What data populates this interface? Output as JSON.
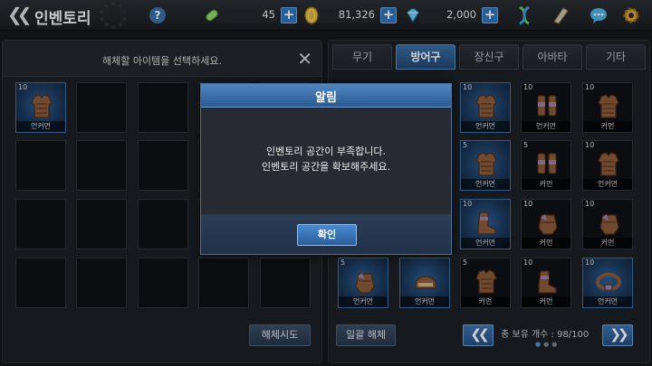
{
  "header": {
    "title": "인벤토리",
    "energy": "45",
    "gold": "81,326",
    "gems": "2,000",
    "plus_label": "+",
    "help_label": "?"
  },
  "left_panel": {
    "prompt": "해체할 아이템을 선택하세요.",
    "close_label": "✕",
    "dismantle_label": "해체시도",
    "slots": [
      {
        "count": "10",
        "name": "언커먼",
        "filled": true
      },
      {
        "filled": false
      },
      {
        "filled": false
      },
      {
        "filled": false
      },
      {
        "filled": false
      },
      {
        "filled": false
      },
      {
        "filled": false
      },
      {
        "filled": false
      },
      {
        "filled": false
      },
      {
        "filled": false
      },
      {
        "filled": false
      },
      {
        "filled": false
      },
      {
        "filled": false
      },
      {
        "filled": false
      },
      {
        "filled": false
      },
      {
        "filled": false
      },
      {
        "filled": false
      },
      {
        "filled": false
      },
      {
        "filled": false
      },
      {
        "filled": false
      }
    ]
  },
  "right_panel": {
    "tabs": [
      "무기",
      "방어구",
      "장신구",
      "아바타",
      "기타"
    ],
    "active_tab": 1,
    "items": [
      {
        "count": "10",
        "name": "언커먼",
        "type": "armor",
        "glow": true
      },
      {
        "count": "10",
        "name": "언커먼",
        "type": "boots",
        "glow": false
      },
      {
        "count": "10",
        "name": "커먼",
        "type": "armor",
        "glow": false
      },
      {
        "count": "5",
        "name": "언커먼",
        "type": "armor",
        "glow": true
      },
      {
        "count": "5",
        "name": "커먼",
        "type": "boots",
        "glow": false
      },
      {
        "count": "10",
        "name": "언커먼",
        "type": "armor",
        "glow": false
      },
      {
        "count": "10",
        "name": "언커먼",
        "type": "boots2",
        "glow": true
      },
      {
        "count": "10",
        "name": "커먼",
        "type": "glove",
        "glow": false
      },
      {
        "count": "10",
        "name": "커먼",
        "type": "glove",
        "glow": false
      },
      {
        "count": "5",
        "name": "언커먼",
        "type": "glove",
        "glow": true
      },
      {
        "count": "",
        "name": "언커먼",
        "type": "helmet",
        "glow": true
      },
      {
        "count": "5",
        "name": "커먼",
        "type": "armor",
        "glow": false
      },
      {
        "count": "10",
        "name": "커먼",
        "type": "boots2",
        "glow": false
      },
      {
        "count": "10",
        "name": "언커먼",
        "type": "belt",
        "glow": true
      }
    ],
    "bulk_label": "일괄 해체",
    "count_label": "총 보유 개수 : 98/100",
    "prev_label": "«",
    "next_label": "»",
    "page_dots": [
      "●",
      "●",
      "●"
    ]
  },
  "dialog": {
    "title": "알림",
    "line1": "인벤토리 공간이 부족합니다.",
    "line2": "인벤토리 공간을 확보해주세요.",
    "ok_label": "확인"
  }
}
